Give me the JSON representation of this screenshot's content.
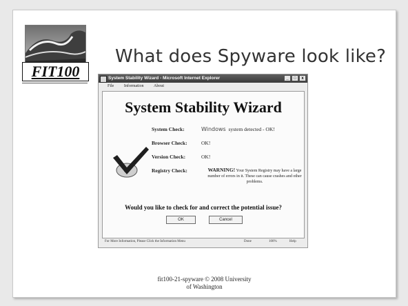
{
  "slide": {
    "title": "What does Spyware look like?",
    "logo_text": "FIT100",
    "footer_line1": "fit100-21-spyware © 2008 University",
    "footer_line2": "of Washington"
  },
  "browser": {
    "title": "System Stability Wizard - Microsoft Internet Explorer",
    "controls": [
      "_",
      "□",
      "x"
    ],
    "menu": [
      "File",
      "Information",
      "About"
    ],
    "status": {
      "message": "For More Information, Please Click the Information Menu",
      "done": "Done",
      "zoom": "100%",
      "help": "Help"
    }
  },
  "wizard": {
    "title": "System Stability Wizard",
    "checks": [
      {
        "label": "System Check:",
        "value_word": "Windows",
        "value": "system detected - OK!"
      },
      {
        "label": "Browser Check:",
        "value": "OK!"
      },
      {
        "label": "Version Check:",
        "value": "OK!"
      },
      {
        "label": "Registry Check:",
        "warning": "WARNING!",
        "value": "Your System Registry may have a large number of errors in it. These can cause crashes and other problems."
      }
    ],
    "question": "Would you like to check for and correct the potential issue?",
    "ok_label": "OK",
    "cancel_label": "Cancel"
  },
  "icons": {
    "logo": "wave-photo",
    "wizard": "checkmark-disc-icon",
    "window": "ie-window-icon"
  },
  "colors": {
    "titlebar": "#4a4a4a",
    "slide_bg": "#ffffff",
    "frame_bg": "#e9e9e9"
  }
}
